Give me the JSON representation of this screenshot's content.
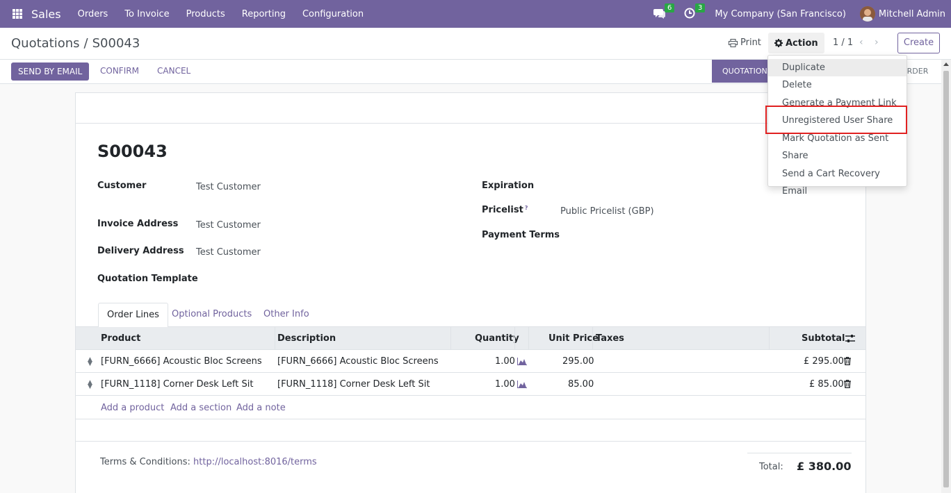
{
  "navbar": {
    "app_name": "Sales",
    "menu": [
      "Orders",
      "To Invoice",
      "Products",
      "Reporting",
      "Configuration"
    ],
    "chat_count": "6",
    "activity_count": "3",
    "company": "My Company (San Francisco)",
    "user": "Mitchell Admin",
    "accent": "#71639e"
  },
  "control": {
    "breadcrumb_parent": "Quotations",
    "breadcrumb_sep": "/",
    "breadcrumb_current": "S00043",
    "print_label": "Print",
    "action_label": "Action",
    "pager": "1 / 1",
    "create_label": "Create"
  },
  "status": {
    "send_email": "SEND BY EMAIL",
    "confirm": "CONFIRM",
    "cancel": "CANCEL",
    "stage_quotation": "QUOTATION",
    "stage_order": "ORDER"
  },
  "form": {
    "title": "S00043",
    "customer_label": "Customer",
    "customer": "Test Customer",
    "invoice_label": "Invoice Address",
    "invoice": "Test Customer",
    "delivery_label": "Delivery Address",
    "delivery": "Test Customer",
    "template_label": "Quotation Template",
    "expiration_label": "Expiration",
    "pricelist_label": "Pricelist",
    "pricelist_help": "?",
    "pricelist": "Public Pricelist (GBP)",
    "payment_terms_label": "Payment Terms"
  },
  "tabs": [
    "Order Lines",
    "Optional Products",
    "Other Info"
  ],
  "table": {
    "headers": {
      "product": "Product",
      "description": "Description",
      "quantity": "Quantity",
      "unit_price": "Unit Price",
      "taxes": "Taxes",
      "subtotal": "Subtotal"
    },
    "rows": [
      {
        "product": "[FURN_6666] Acoustic Bloc Screens",
        "description": "[FURN_6666] Acoustic Bloc Screens",
        "quantity": "1.00",
        "unit_price": "295.00",
        "taxes": "",
        "subtotal": "£ 295.00"
      },
      {
        "product": "[FURN_1118] Corner Desk Left Sit",
        "description": "[FURN_1118] Corner Desk Left Sit",
        "quantity": "1.00",
        "unit_price": "85.00",
        "taxes": "",
        "subtotal": "£ 85.00"
      }
    ],
    "add_product": "Add a product",
    "add_section": "Add a section",
    "add_note": "Add a note"
  },
  "footer": {
    "terms_label": "Terms & Conditions:",
    "terms_link": "http://localhost:8016/terms",
    "total_label": "Total:",
    "total_value": "£ 380.00"
  },
  "action_menu": {
    "items": [
      "Duplicate",
      "Delete",
      "Generate a Payment Link",
      "Unregistered User Share",
      "Mark Quotation as Sent",
      "Share",
      "Send a Cart Recovery Email"
    ]
  }
}
